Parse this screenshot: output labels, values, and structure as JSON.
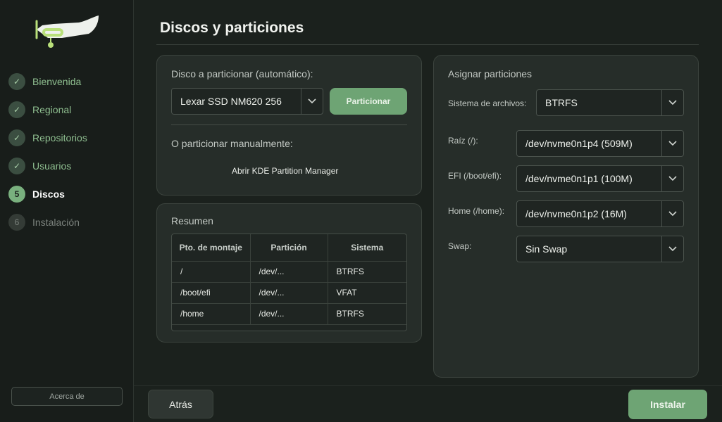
{
  "sidebar": {
    "steps": [
      {
        "num": "✓",
        "label": "Bienvenida",
        "state": "done"
      },
      {
        "num": "✓",
        "label": "Regional",
        "state": "done"
      },
      {
        "num": "✓",
        "label": "Repositorios",
        "state": "done"
      },
      {
        "num": "✓",
        "label": "Usuarios",
        "state": "done"
      },
      {
        "num": "5",
        "label": "Discos",
        "state": "active"
      },
      {
        "num": "6",
        "label": "Instalación",
        "state": "todo"
      }
    ],
    "about_label": "Acerca de"
  },
  "page": {
    "title": "Discos y particiones"
  },
  "auto_panel": {
    "disk_label": "Disco a particionar (automático):",
    "disk_value": "Lexar SSD NM620 256",
    "partition_button": "Particionar",
    "manual_label": "O particionar manualmente:",
    "kde_link": "Abrir KDE Partition Manager"
  },
  "summary": {
    "title": "Resumen",
    "headers": [
      "Pto. de montaje",
      "Partición",
      "Sistema"
    ],
    "rows": [
      [
        "/",
        "/dev/...",
        "BTRFS"
      ],
      [
        "/boot/efi",
        "/dev/...",
        "VFAT"
      ],
      [
        "/home",
        "/dev/...",
        "BTRFS"
      ]
    ]
  },
  "assign": {
    "title": "Asignar particiones",
    "fs_label": "Sistema de archivos:",
    "fs_value": "BTRFS",
    "root_label": "Raíz (/):",
    "root_value": "/dev/nvme0n1p4 (509M)",
    "efi_label": "EFI (/boot/efi):",
    "efi_value": "/dev/nvme0n1p1 (100M)",
    "home_label": "Home (/home):",
    "home_value": "/dev/nvme0n1p2 (16M)",
    "swap_label": "Swap:",
    "swap_value": "Sin Swap"
  },
  "footer": {
    "back_label": "Atrás",
    "install_label": "Instalar"
  },
  "colors": {
    "accent": "#6ea474",
    "background": "#1b211d",
    "panel": "#262d29"
  }
}
